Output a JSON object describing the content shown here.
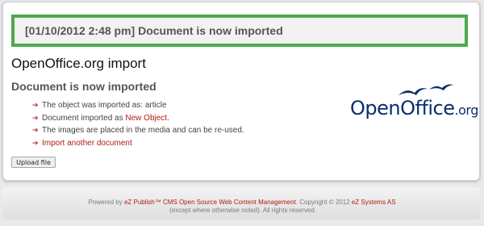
{
  "feedback": {
    "message": "[01/10/2012 2:48 pm] Document is now imported"
  },
  "page": {
    "title": "OpenOffice.org import",
    "section_title": "Document is now imported"
  },
  "results": {
    "item1": "The object was imported as: article",
    "item2_prefix": "Document imported as ",
    "item2_link": "New Object",
    "item2_suffix": ".",
    "item3": "The images are placed in the media and can be re-used.",
    "item4_link": "Import another document"
  },
  "upload_button": {
    "label": "Upload file"
  },
  "logo": {
    "brand": "OpenOffice",
    "suffix": ".org"
  },
  "footer": {
    "prefix": "Powered by ",
    "link1": "eZ Publish™ CMS Open Source Web Content Management",
    "middle": ". Copyright © 2012 ",
    "link2": "eZ Systems AS",
    "suffix": " (except where otherwise noted). All rights reserved."
  },
  "colors": {
    "feedback_border": "#4caa4a",
    "link": "#b01c12",
    "logo_blue": "#0b2e6e"
  }
}
